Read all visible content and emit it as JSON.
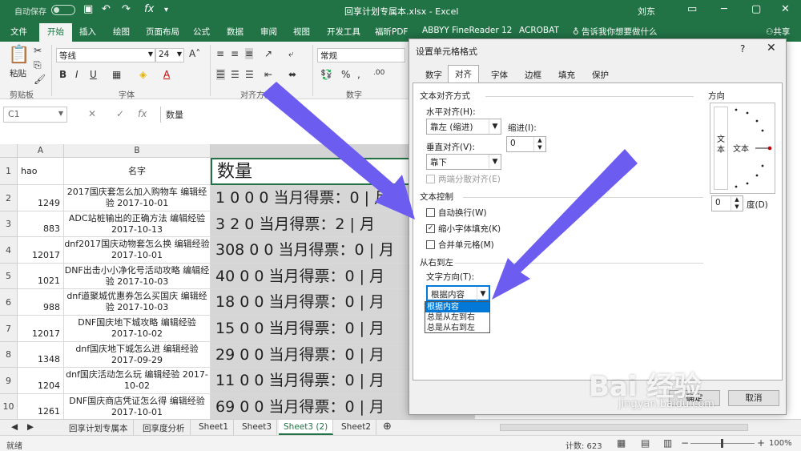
{
  "titlebar": {
    "autosave": "自动保存",
    "toggle_state": "关",
    "title": "回享计划专属本.xlsx  -  Excel",
    "user": "刘东",
    "qat": [
      "💾",
      "↶",
      "↷",
      "fx",
      "▾"
    ]
  },
  "tabs": [
    "文件",
    "开始",
    "插入",
    "绘图",
    "页面布局",
    "公式",
    "数据",
    "审阅",
    "视图",
    "开发工具",
    "福昕PDF",
    "ABBYY FineReader 12",
    "ACROBAT",
    "告诉我你想要做什么",
    "共享"
  ],
  "ribbon": {
    "paste": "粘贴",
    "clipboard": "剪贴板",
    "font_name": "等线",
    "font_size": "24",
    "font": "字体",
    "alignment": "对齐方式",
    "number_format": "常规",
    "number": "数字"
  },
  "formula_bar": {
    "name_box": "C1",
    "content": "数量"
  },
  "grid": {
    "columns": [
      "A",
      "B",
      "C"
    ],
    "header_row": {
      "row": "1",
      "a": "hao",
      "b": "名字",
      "c": "数量"
    },
    "rows": [
      {
        "row": "2",
        "a": "1249",
        "b": "2017国庆套怎么加入购物车 编辑经验 2017-10-01",
        "c": "1 0 0 0 当月得票：0 | 月"
      },
      {
        "row": "3",
        "a": "883",
        "b": "ADC站桩输出的正确方法 编辑经验 2017-10-13",
        "c": "3 2 0 当月得票：2 | 月"
      },
      {
        "row": "4",
        "a": "12017",
        "b": "dnf2017国庆动物套怎么换 编辑经验 2017-10-01",
        "c": "308 0 0 当月得票：0 | 月"
      },
      {
        "row": "5",
        "a": "1021",
        "b": "DNF出击小小净化号活动攻略 编辑经验 2017-10-03",
        "c": "40 0 0 当月得票：0 | 月"
      },
      {
        "row": "6",
        "a": "988",
        "b": "dnf道聚城优惠券怎么买国庆 编辑经验 2017-10-03",
        "c": "18 0 0 当月得票：0 | 月"
      },
      {
        "row": "7",
        "a": "12017",
        "b": "DNF国庆地下城攻略 编辑经验 2017-10-02",
        "c": "15 0 0 当月得票：0 | 月"
      },
      {
        "row": "8",
        "a": "1348",
        "b": "dnf国庆地下城怎么进 编辑经验 2017-09-29",
        "c": "29 0 0 当月得票：0 | 月"
      },
      {
        "row": "9",
        "a": "1204",
        "b": "dnf国庆活动怎么玩 编辑经验 2017-10-02",
        "c": "11 0 0 当月得票：0 | 月"
      },
      {
        "row": "10",
        "a": "1261",
        "b": "DNF国庆商店凭证怎么得 编辑经验 2017-10-01",
        "c": "69 0 0 当月得票：0 | 月"
      }
    ]
  },
  "sheet_tabs": [
    "回享计划专属本",
    "回享度分析",
    "Sheet1",
    "Sheet3",
    "Sheet3 (2)",
    "Sheet2"
  ],
  "active_sheet": "Sheet3 (2)",
  "status": {
    "mode": "就绪",
    "count": "计数: 623",
    "zoom": "100%"
  },
  "dialog": {
    "title": "设置单元格格式",
    "help": "?",
    "close": "✕",
    "tabs": [
      "数字",
      "对齐",
      "字体",
      "边框",
      "填充",
      "保护"
    ],
    "active_tab": "对齐",
    "text_alignment": "文本对齐方式",
    "horizontal_label": "水平对齐(H):",
    "horizontal_value": "靠左 (缩进)",
    "indent_label": "缩进(I):",
    "indent_value": "0",
    "vertical_label": "垂直对齐(V):",
    "vertical_value": "靠下",
    "justify_distributed": "两端分散对齐(E)",
    "text_control": "文本控制",
    "wrap_text": "自动换行(W)",
    "shrink_to_fit": "缩小字体填充(K)",
    "merge_cells": "合并单元格(M)",
    "rtl": "从右到左",
    "text_direction_label": "文字方向(T):",
    "text_direction_value": "根据内容",
    "text_direction_options": [
      "根据内容",
      "总是从左到右",
      "总是从右到左"
    ],
    "orientation": "方向",
    "orientation_vertical": "文本",
    "orientation_text": "文本",
    "degree_value": "0",
    "degree_label": "度(D)",
    "ok": "确定",
    "cancel": "取消"
  },
  "watermark": {
    "logo": "Bai 经验",
    "url": "jingyan.baidu.com"
  },
  "colors": {
    "excel_green": "#217346",
    "arrow": "#6d5cf0",
    "selection_blue": "#0078d7"
  }
}
